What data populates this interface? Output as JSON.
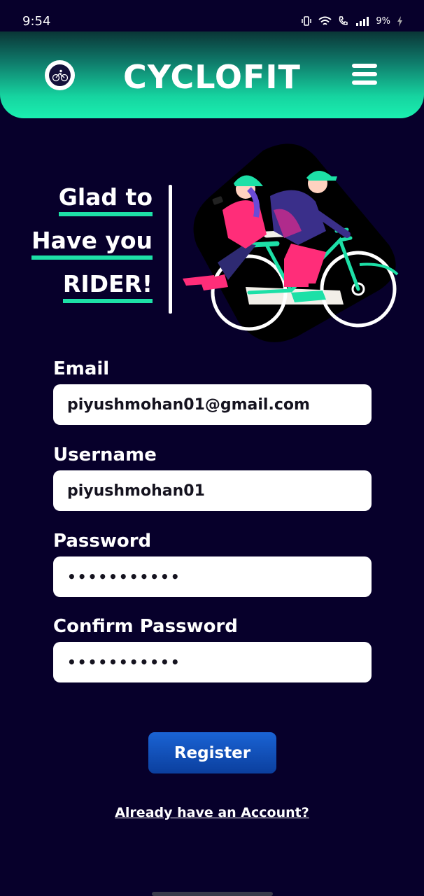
{
  "status_bar": {
    "time": "9:54",
    "battery": "9%",
    "icons": [
      "vibrate-icon",
      "wifi-icon",
      "wifi-call-icon",
      "signal-icon",
      "battery-charging-icon"
    ]
  },
  "header": {
    "title": "CYCLOFIT",
    "logo_icon": "cyclist-logo-icon",
    "menu_icon": "hamburger-menu-icon",
    "colors": {
      "gradient_top": "#0a3536",
      "gradient_bottom": "#1af0b0"
    }
  },
  "greeting": {
    "line1": "Glad to",
    "line2": "Have you",
    "line3": "RIDER!"
  },
  "illustration": "couple-riding-bicycle-illustration",
  "form": {
    "email_label": "Email",
    "email_value": "piyushmohan01@gmail.com",
    "username_label": "Username",
    "username_value": "piyushmohan01",
    "password_label": "Password",
    "password_value": "•••••••••••",
    "confirm_label": "Confirm Password",
    "confirm_value": "•••••••••••"
  },
  "register_label": "Register",
  "login_link": "Already have an Account?",
  "colors": {
    "background": "#07002b",
    "accent": "#1de0a7",
    "button": "#1558c0"
  }
}
